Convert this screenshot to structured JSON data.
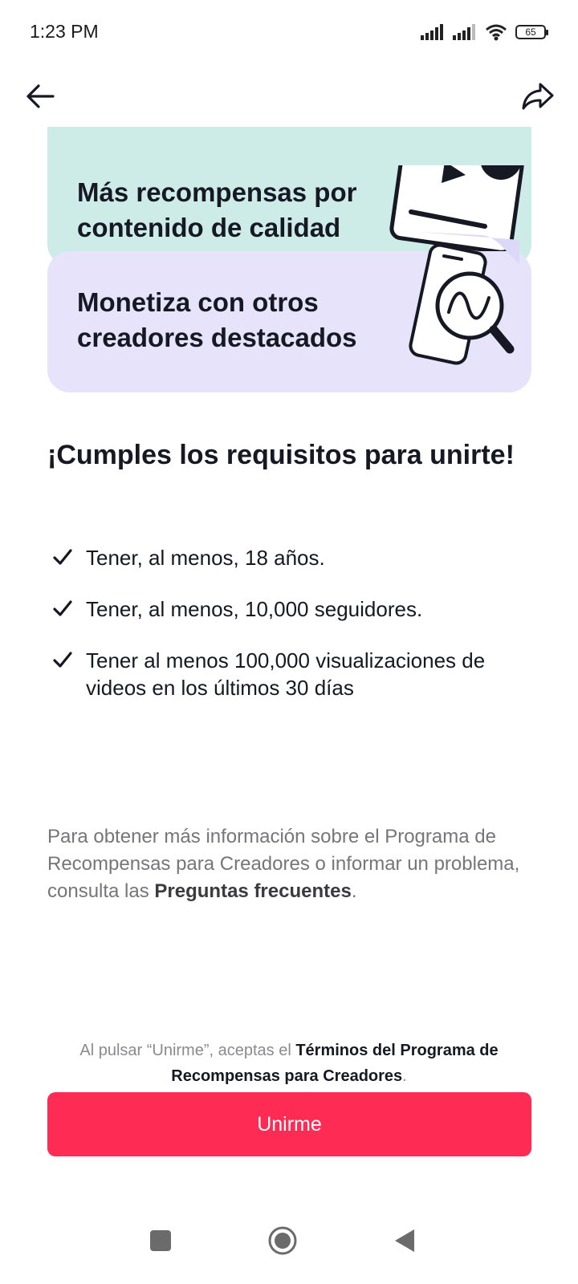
{
  "status_bar": {
    "time": "1:23 PM",
    "battery": "65"
  },
  "nav": {
    "back_icon": "arrow-left-icon",
    "share_icon": "share-icon"
  },
  "cards": [
    {
      "title": "Más recompensas por contenido de calidad",
      "color": "#cdece7"
    },
    {
      "title": "Monetiza con otros creadores destacados",
      "color": "#e6e3fb"
    }
  ],
  "requirements": {
    "title": "¡Cumples los requisitos para unirte!",
    "items": [
      "Tener, al menos, 18 años.",
      "Tener, al menos, 10,000 seguidores.",
      "Tener al menos 100,000 visualizaciones de videos en los últimos 30 días"
    ]
  },
  "info": {
    "text": "Para obtener más información sobre el Programa de Recompensas para Creadores o informar un problema, consulta las ",
    "link": "Preguntas frecuentes",
    "suffix": "."
  },
  "terms": {
    "prefix": "Al pulsar “Unirme”, aceptas el ",
    "link": "Términos del Programa de Recompensas para Creadores",
    "suffix": "."
  },
  "join_button": {
    "label": "Unirme",
    "color": "#fe2c55"
  }
}
